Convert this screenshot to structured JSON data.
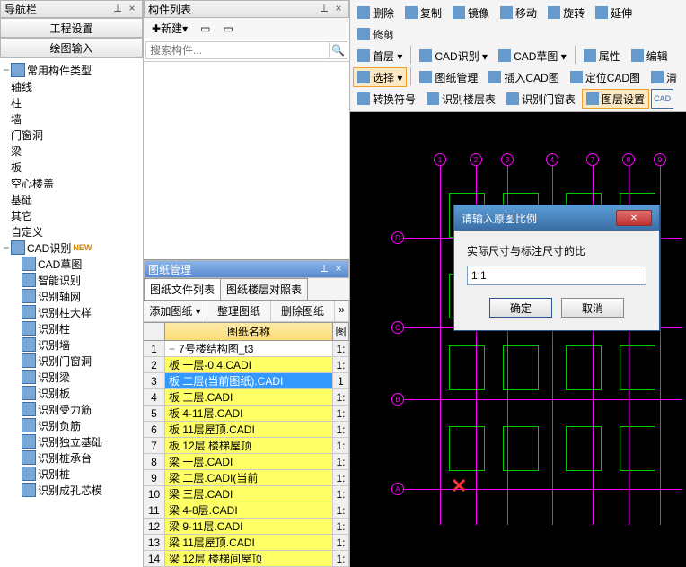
{
  "sidebar": {
    "title": "导航栏",
    "btns": [
      "工程设置",
      "绘图输入"
    ],
    "nodes": [
      {
        "lvl": 0,
        "tw": "−",
        "ic": 1,
        "label": "常用构件类型"
      },
      {
        "lvl": 0,
        "tw": "",
        "label": "轴线"
      },
      {
        "lvl": 0,
        "tw": "",
        "label": "柱"
      },
      {
        "lvl": 0,
        "tw": "",
        "label": "墙"
      },
      {
        "lvl": 0,
        "tw": "",
        "label": "门窗洞"
      },
      {
        "lvl": 0,
        "tw": "",
        "label": "梁"
      },
      {
        "lvl": 0,
        "tw": "",
        "label": "板"
      },
      {
        "lvl": 0,
        "tw": "",
        "label": "空心楼盖"
      },
      {
        "lvl": 0,
        "tw": "",
        "label": "基础"
      },
      {
        "lvl": 0,
        "tw": "",
        "label": "其它"
      },
      {
        "lvl": 0,
        "tw": "",
        "label": "自定义"
      },
      {
        "lvl": 0,
        "tw": "−",
        "ic": 1,
        "label": "CAD识别",
        "new": "NEW"
      },
      {
        "lvl": 1,
        "ic": 1,
        "label": "CAD草图"
      },
      {
        "lvl": 1,
        "ic": 1,
        "label": "智能识别"
      },
      {
        "lvl": 1,
        "ic": 1,
        "label": "识别轴网"
      },
      {
        "lvl": 1,
        "ic": 1,
        "label": "识别柱大样"
      },
      {
        "lvl": 1,
        "ic": 1,
        "label": "识别柱"
      },
      {
        "lvl": 1,
        "ic": 1,
        "label": "识别墙"
      },
      {
        "lvl": 1,
        "ic": 1,
        "label": "识别门窗洞"
      },
      {
        "lvl": 1,
        "ic": 1,
        "label": "识别梁"
      },
      {
        "lvl": 1,
        "ic": 1,
        "label": "识别板"
      },
      {
        "lvl": 1,
        "ic": 1,
        "label": "识别受力筋"
      },
      {
        "lvl": 1,
        "ic": 1,
        "label": "识别负筋"
      },
      {
        "lvl": 1,
        "ic": 1,
        "label": "识别独立基础"
      },
      {
        "lvl": 1,
        "ic": 1,
        "label": "识别桩承台"
      },
      {
        "lvl": 1,
        "ic": 1,
        "label": "识别桩"
      },
      {
        "lvl": 1,
        "ic": 1,
        "label": "识别成孔芯模"
      }
    ]
  },
  "components": {
    "title": "构件列表",
    "new_btn": "新建",
    "search_ph": "搜索构件..."
  },
  "drawings": {
    "title": "图纸管理",
    "tabs": [
      "图纸文件列表",
      "图纸楼层对照表"
    ],
    "toolbar": [
      "添加图纸",
      "整理图纸",
      "删除图纸"
    ],
    "headers": {
      "name": "图纸名称",
      "scale": "图"
    },
    "rows": [
      {
        "n": 1,
        "tw": "−",
        "name": "7号楼结构图_t3",
        "s": "1:",
        "plain": true
      },
      {
        "n": 2,
        "name": "板 一层-0.4.CADI",
        "s": "1:"
      },
      {
        "n": 3,
        "name": "板 二层(当前图纸).CADI",
        "s": "1",
        "sel": true
      },
      {
        "n": 4,
        "name": "板 三层.CADI",
        "s": "1:"
      },
      {
        "n": 5,
        "name": "板 4-11层.CADI",
        "s": "1:"
      },
      {
        "n": 6,
        "name": "板 11层屋顶.CADI",
        "s": "1:"
      },
      {
        "n": 7,
        "name": "板 12层 楼梯屋顶",
        "s": "1:"
      },
      {
        "n": 8,
        "name": "梁 一层.CADI",
        "s": "1:"
      },
      {
        "n": 9,
        "name": "梁 二层.CADI(当前",
        "s": "1:"
      },
      {
        "n": 10,
        "name": "梁 三层.CADI",
        "s": "1:"
      },
      {
        "n": 11,
        "name": "梁 4-8层.CADI",
        "s": "1:"
      },
      {
        "n": 12,
        "name": "梁 9-11层.CADI",
        "s": "1:"
      },
      {
        "n": 13,
        "name": "梁 11层屋顶.CADI",
        "s": "1:"
      },
      {
        "n": 14,
        "name": "梁 12层 楼梯间屋顶",
        "s": "1:"
      }
    ]
  },
  "canvas_toolbar": {
    "r1": [
      "删除",
      "复制",
      "镜像",
      "移动",
      "旋转",
      "延伸",
      "修剪"
    ],
    "r2_floor": "首层",
    "r2_cad1": "CAD识别",
    "r2_cad2": "CAD草图",
    "r2_attr": "属性",
    "r2_edit": "编辑",
    "r3_sel": "选择",
    "r3": [
      "图纸管理",
      "插入CAD图",
      "定位CAD图",
      "清"
    ],
    "r4": [
      "转换符号",
      "识别楼层表",
      "识别门窗表",
      "图层设置"
    ],
    "r4_cad": "CAD"
  },
  "dialog": {
    "title": "请输入原图比例",
    "label": "实际尺寸与标注尺寸的比",
    "value": "1:1",
    "ok": "确定",
    "cancel": "取消"
  },
  "axis_top": [
    "1",
    "2",
    "3",
    "4",
    "7",
    "8",
    "9"
  ],
  "axis_left": [
    "D",
    "C",
    "B",
    "A"
  ]
}
